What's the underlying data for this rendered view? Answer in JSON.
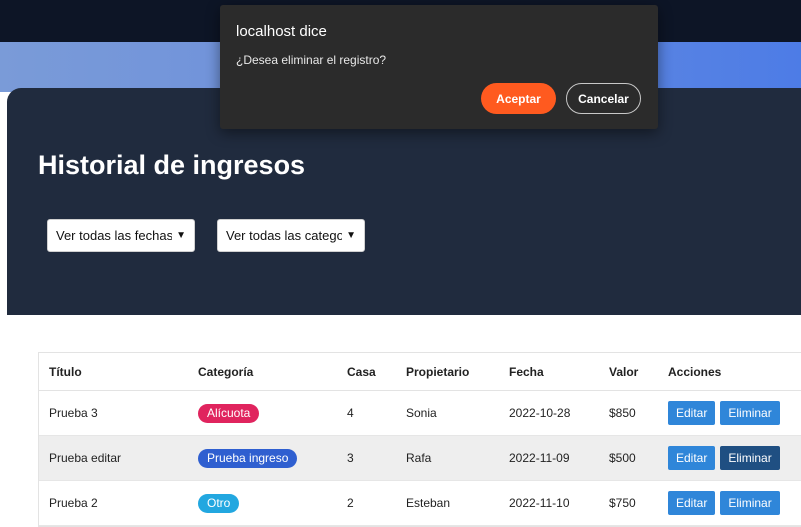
{
  "dialog": {
    "title": "localhost dice",
    "message": "¿Desea eliminar el registro?",
    "ok_label": "Aceptar",
    "cancel_label": "Cancelar",
    "ok_color": "#ff5a1f"
  },
  "hero": {
    "title": "Historial de ingresos",
    "filter_dates": "Ver todas las fechas",
    "filter_categories": "Ver todas las categorías"
  },
  "table": {
    "headers": [
      "Título",
      "Categoría",
      "Casa",
      "Propietario",
      "Fecha",
      "Valor",
      "Acciones"
    ],
    "rows": [
      {
        "titulo": "Prueba 3",
        "categoria": "Alícuota",
        "categoria_color": "#e0245e",
        "casa": "4",
        "propietario": "Sonia",
        "fecha": "2022-10-28",
        "valor": "$850",
        "edit_label": "Editar",
        "delete_label": "Eliminar"
      },
      {
        "titulo": "Prueba editar",
        "categoria": "Prueba ingreso",
        "categoria_color": "#2f5fd0",
        "casa": "3",
        "propietario": "Rafa",
        "fecha": "2022-11-09",
        "valor": "$500",
        "edit_label": "Editar",
        "delete_label": "Eliminar"
      },
      {
        "titulo": "Prueba 2",
        "categoria": "Otro",
        "categoria_color": "#22a7e0",
        "casa": "2",
        "propietario": "Esteban",
        "fecha": "2022-11-10",
        "valor": "$750",
        "edit_label": "Editar",
        "delete_label": "Eliminar"
      }
    ]
  }
}
